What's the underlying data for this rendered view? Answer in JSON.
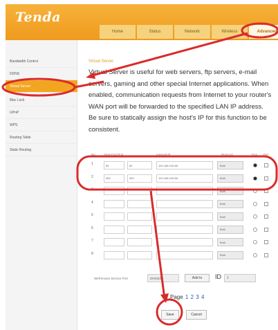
{
  "header": {
    "logo": "Tenda",
    "nav": [
      "Home",
      "Status",
      "Network",
      "Wireless",
      "Advanced"
    ],
    "active_nav": 4
  },
  "sidebar": {
    "items": [
      "Bandwidth Control",
      "DDNS",
      "Virtual Server",
      "Mac Lock",
      "UPnP",
      "WPS",
      "Routing Table",
      "Static Routing"
    ],
    "active_item": 2
  },
  "main": {
    "title": "Virtual Server",
    "description": "Virtual Server is useful for web servers, ftp servers, e-mail servers, gaming and other special Internet applications. When enabled, communication requests from Internet to your router's WAN port will be forwarded to the specified LAN IP address. Be sure to statically assign the host's IP for this function to be consistent."
  },
  "table": {
    "headers": [
      "No.",
      "Start-End Port",
      "Internal IP",
      "Protocol",
      "Ena",
      "Del"
    ],
    "rows": [
      {
        "no": "1",
        "start": "80",
        "end": "80",
        "ip": "192.168.100.88",
        "protocol": "Both",
        "enabled": true
      },
      {
        "no": "2",
        "start": "553",
        "end": "553",
        "ip": "192.168.100.88",
        "protocol": "Both",
        "enabled": true
      },
      {
        "no": "3",
        "start": "",
        "end": "",
        "ip": "",
        "protocol": "Both",
        "enabled": false
      },
      {
        "no": "4",
        "start": "",
        "end": "",
        "ip": "",
        "protocol": "Both",
        "enabled": false
      },
      {
        "no": "5",
        "start": "",
        "end": "",
        "ip": "",
        "protocol": "Both",
        "enabled": false
      },
      {
        "no": "6",
        "start": "",
        "end": "",
        "ip": "",
        "protocol": "Both",
        "enabled": false
      },
      {
        "no": "7",
        "start": "",
        "end": "",
        "ip": "",
        "protocol": "Both",
        "enabled": false
      },
      {
        "no": "8",
        "start": "",
        "end": "",
        "ip": "",
        "protocol": "Both",
        "enabled": false
      }
    ]
  },
  "controls": {
    "wellknown_label": "Well-known Service Port",
    "wellknown_value": "DNS(53)",
    "add_to": "Add to",
    "id_label": "ID",
    "id_value": "1",
    "pager_label": "Page",
    "pages": [
      "1",
      "2",
      "3",
      "4"
    ],
    "save": "Save",
    "cancel": "Cancel"
  },
  "colors": {
    "accent": "#f3a521",
    "annotation": "#d92b2b",
    "link": "#2a5db0"
  }
}
